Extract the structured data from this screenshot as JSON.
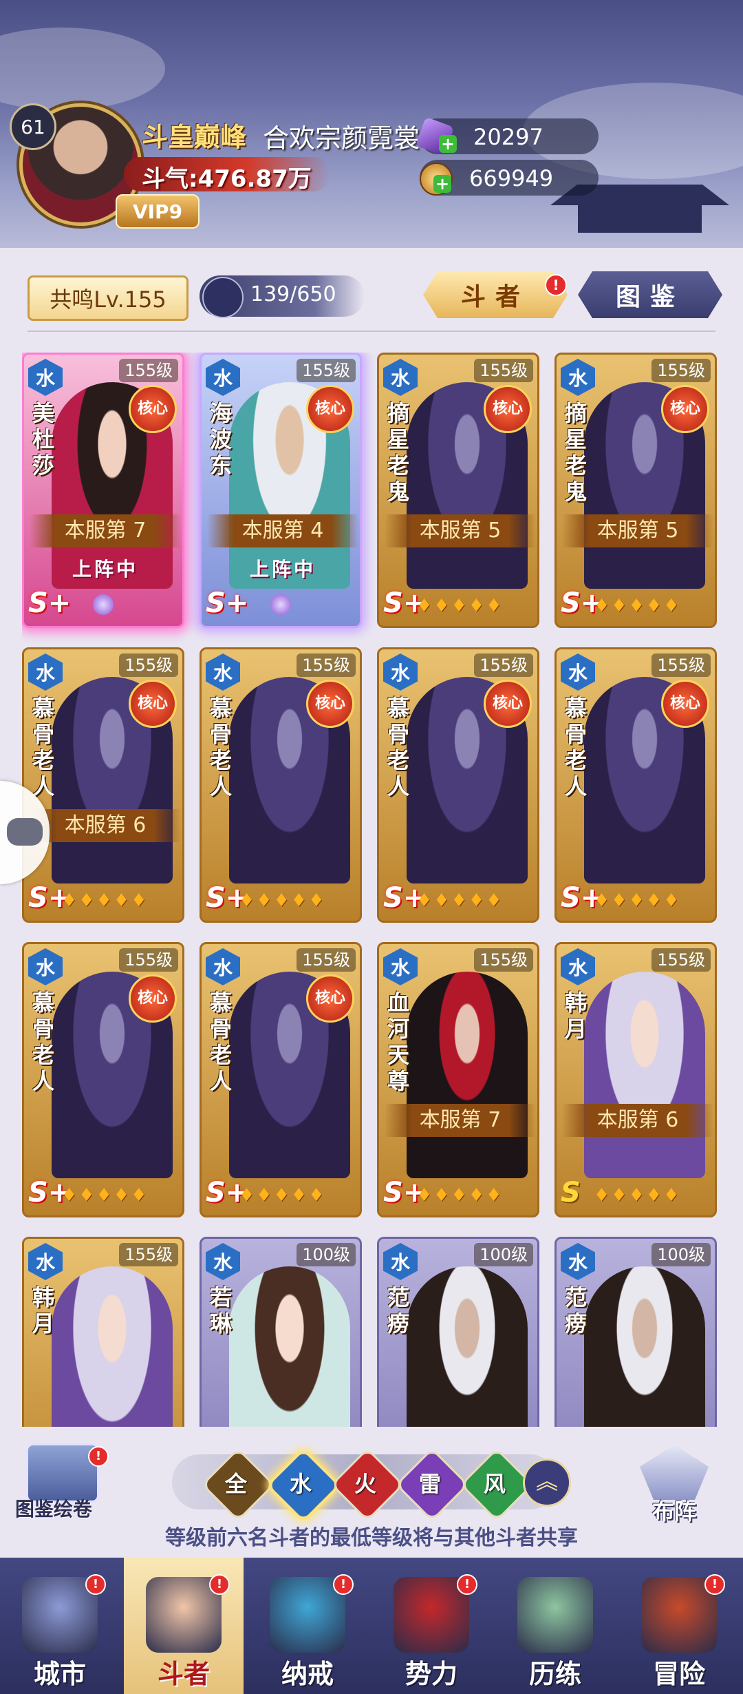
{
  "player": {
    "level": "61",
    "title": "斗皇巅峰",
    "name": "合欢宗颜霓裳",
    "power": "斗气:476.87万",
    "vip": "VIP9"
  },
  "resources": [
    {
      "icon": "purple-gem-icon",
      "value": "20297"
    },
    {
      "icon": "gold-coin-icon",
      "value": "669949"
    }
  ],
  "toolbar": {
    "resonance": "共鸣Lv.155",
    "slots": "139/650",
    "tabs": [
      {
        "label": "斗者",
        "active": true,
        "badge": "!"
      },
      {
        "label": "图鉴",
        "active": false
      }
    ]
  },
  "cards": [
    {
      "element": "水",
      "level": "155级",
      "name": "美杜莎",
      "core": "核心",
      "rank": "本服第 7",
      "status": "上阵中",
      "grade": "S+",
      "stars": "",
      "frame": "pink",
      "portrait": "medusa"
    },
    {
      "element": "水",
      "level": "155级",
      "name": "海波东",
      "core": "核心",
      "rank": "本服第 4",
      "status": "上阵中",
      "grade": "S+",
      "stars": "",
      "frame": "blue",
      "portrait": "haibo"
    },
    {
      "element": "水",
      "level": "155级",
      "name": "摘星老鬼",
      "core": "核心",
      "rank": "本服第 5",
      "status": "",
      "grade": "S+",
      "stars": "♦♦♦♦♦",
      "frame": "gold",
      "portrait": "hood"
    },
    {
      "element": "水",
      "level": "155级",
      "name": "摘星老鬼",
      "core": "核心",
      "rank": "本服第 5",
      "status": "",
      "grade": "S+",
      "stars": "♦♦♦♦♦",
      "frame": "gold",
      "portrait": "hood"
    },
    {
      "element": "水",
      "level": "155级",
      "name": "慕骨老人",
      "core": "核心",
      "rank": "本服第 6",
      "status": "",
      "grade": "S+",
      "stars": "♦♦♦♦♦",
      "frame": "gold",
      "portrait": "hood"
    },
    {
      "element": "水",
      "level": "155级",
      "name": "慕骨老人",
      "core": "核心",
      "rank": "",
      "status": "",
      "grade": "S+",
      "stars": "♦♦♦♦♦",
      "frame": "gold",
      "portrait": "hood"
    },
    {
      "element": "水",
      "level": "155级",
      "name": "慕骨老人",
      "core": "核心",
      "rank": "",
      "status": "",
      "grade": "S+",
      "stars": "♦♦♦♦♦",
      "frame": "gold",
      "portrait": "hood"
    },
    {
      "element": "水",
      "level": "155级",
      "name": "慕骨老人",
      "core": "核心",
      "rank": "",
      "status": "",
      "grade": "S+",
      "stars": "♦♦♦♦♦",
      "frame": "gold",
      "portrait": "hood"
    },
    {
      "element": "水",
      "level": "155级",
      "name": "慕骨老人",
      "core": "核心",
      "rank": "",
      "status": "",
      "grade": "S+",
      "stars": "♦♦♦♦♦",
      "frame": "gold",
      "portrait": "hood"
    },
    {
      "element": "水",
      "level": "155级",
      "name": "慕骨老人",
      "core": "核心",
      "rank": "",
      "status": "",
      "grade": "S+",
      "stars": "♦♦♦♦♦",
      "frame": "gold",
      "portrait": "hood"
    },
    {
      "element": "水",
      "level": "155级",
      "name": "血河天尊",
      "core": "",
      "rank": "本服第 7",
      "status": "",
      "grade": "S+",
      "stars": "♦♦♦♦♦",
      "frame": "gold",
      "portrait": "xuehe"
    },
    {
      "element": "水",
      "level": "155级",
      "name": "韩月",
      "core": "",
      "rank": "本服第 6",
      "status": "",
      "grade": "S",
      "stars": "♦♦♦♦♦",
      "frame": "gold",
      "portrait": "hanyue"
    },
    {
      "element": "水",
      "level": "155级",
      "name": "韩月",
      "core": "",
      "rank": "",
      "status": "",
      "grade": "",
      "stars": "",
      "frame": "gold",
      "portrait": "hanyue"
    },
    {
      "element": "水",
      "level": "100级",
      "name": "若琳",
      "core": "",
      "rank": "",
      "status": "",
      "grade": "",
      "stars": "",
      "frame": "purple",
      "portrait": "ruolin"
    },
    {
      "element": "水",
      "level": "100级",
      "name": "范痨",
      "core": "",
      "rank": "",
      "status": "",
      "grade": "",
      "stars": "",
      "frame": "purple",
      "portrait": "fanlao"
    },
    {
      "element": "水",
      "level": "100级",
      "name": "范痨",
      "core": "",
      "rank": "",
      "status": "",
      "grade": "",
      "stars": "",
      "frame": "purple",
      "portrait": "fanlao"
    }
  ],
  "filters": [
    {
      "label": "全",
      "color": "#6b4a1e",
      "selected": false
    },
    {
      "label": "水",
      "color": "#2b6fc4",
      "selected": true
    },
    {
      "label": "火",
      "color": "#c4282b",
      "selected": false
    },
    {
      "label": "雷",
      "color": "#7a3fb6",
      "selected": false
    },
    {
      "label": "风",
      "color": "#2f9a4a",
      "selected": false
    }
  ],
  "side_buttons": {
    "atlas_scroll": "图鉴绘卷",
    "formation": "布阵",
    "badge": "!"
  },
  "notice": "等级前六名斗者的最低等级将与其他斗者共享",
  "nav": [
    {
      "label": "城市",
      "icon": "city-icon",
      "active": false,
      "badge": "!"
    },
    {
      "label": "斗者",
      "icon": "fighter-icon",
      "active": true,
      "badge": "!"
    },
    {
      "label": "纳戒",
      "icon": "ring-icon",
      "active": false,
      "badge": "!"
    },
    {
      "label": "势力",
      "icon": "faction-icon",
      "active": false,
      "badge": "!"
    },
    {
      "label": "历练",
      "icon": "training-icon",
      "active": false,
      "badge": ""
    },
    {
      "label": "冒险",
      "icon": "adventure-icon",
      "active": false,
      "badge": "!"
    }
  ]
}
